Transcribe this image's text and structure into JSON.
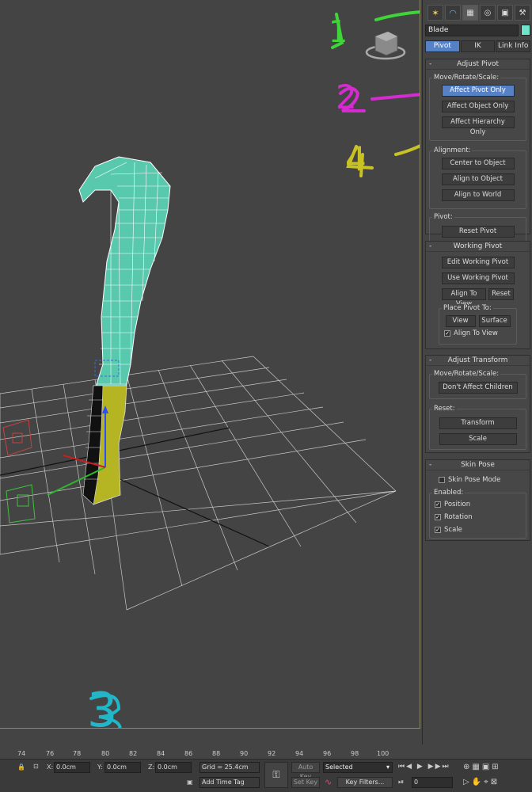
{
  "object_name": "Blade",
  "colors": {
    "object_color": "#6fe4c8",
    "accent": "#5682c5",
    "annot_green": "#3fd43a",
    "annot_magenta": "#d62bd0",
    "annot_yellow": "#c8c223",
    "annot_cyan": "#21b7c9"
  },
  "command_tabs": [
    "create-icon",
    "modify-icon",
    "hierarchy-icon",
    "motion-icon",
    "display-icon",
    "utilities-icon"
  ],
  "sub_tabs": {
    "pivot": "Pivot",
    "ik": "IK",
    "link_info": "Link Info"
  },
  "adjust_pivot": {
    "title": "Adjust Pivot",
    "move_label": "Move/Rotate/Scale:",
    "affect_pivot": "Affect Pivot Only",
    "affect_object": "Affect Object Only",
    "affect_hierarchy": "Affect Hierarchy Only",
    "alignment_label": "Alignment:",
    "center_to_object": "Center to Object",
    "align_to_object": "Align to Object",
    "align_to_world": "Align to World",
    "pivot_label": "Pivot:",
    "reset_pivot": "Reset Pivot"
  },
  "working_pivot": {
    "title": "Working Pivot",
    "edit": "Edit Working Pivot",
    "use": "Use Working Pivot",
    "align_to_view": "Align To View",
    "reset": "Reset",
    "place_label": "Place Pivot To:",
    "view": "View",
    "surface": "Surface",
    "align_to_view_check": "Align To View"
  },
  "adjust_transform": {
    "title": "Adjust Transform",
    "move_label": "Move/Rotate/Scale:",
    "dont_affect": "Don't Affect Children",
    "reset_label": "Reset:",
    "transform": "Transform",
    "scale": "Scale"
  },
  "skin_pose": {
    "title": "Skin Pose",
    "mode": "Skin Pose Mode",
    "enabled_label": "Enabled:",
    "position": "Position",
    "rotation": "Rotation",
    "scale": "Scale"
  },
  "timeline": {
    "ticks": [
      "74",
      "76",
      "78",
      "80",
      "82",
      "84",
      "86",
      "88",
      "90",
      "92",
      "94",
      "96",
      "98",
      "100"
    ]
  },
  "status": {
    "x_label": "X:",
    "x_value": "0.0cm",
    "y_label": "Y:",
    "y_value": "0.0cm",
    "z_label": "Z:",
    "z_value": "0.0cm",
    "grid": "Grid = 25.4cm",
    "add_time_tag": "Add Time Tag",
    "auto_key": "Auto Key",
    "set_key": "Set Key",
    "key_mode": "Selected",
    "key_filters": "Key Filters...",
    "frame": "0"
  },
  "annotations": {
    "one": "1",
    "two": "2",
    "three": "3",
    "four": "4"
  }
}
